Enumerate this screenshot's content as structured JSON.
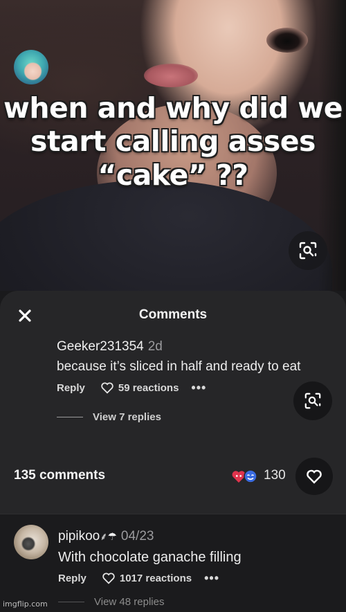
{
  "meme": {
    "caption_lines": [
      "when and why did we",
      "start calling asses",
      "“cake” ??"
    ]
  },
  "sheet": {
    "title": "Comments",
    "comment1": {
      "username": "Geeker231354",
      "time": "2d",
      "text": "because it’s sliced in half and ready to eat",
      "reply_label": "Reply",
      "reactions": "59 reactions",
      "more": "•••",
      "view_replies": "View 7 replies"
    },
    "count_label": "135 comments",
    "reaction_count": "130"
  },
  "lower": {
    "comment": {
      "username": "pipikoo",
      "username_emoji": "⸙☂",
      "time": "04/23",
      "text": "With chocolate ganache filling",
      "reply_label": "Reply",
      "reactions": "1017 reactions",
      "more": "•••",
      "view_replies": "View 48 replies"
    }
  },
  "watermark": "imgflip.com",
  "colors": {
    "sheet_bg": "#262628",
    "button_bg": "#161618",
    "heart_red": "#e0344d",
    "smile_blue": "#3a6be0"
  }
}
